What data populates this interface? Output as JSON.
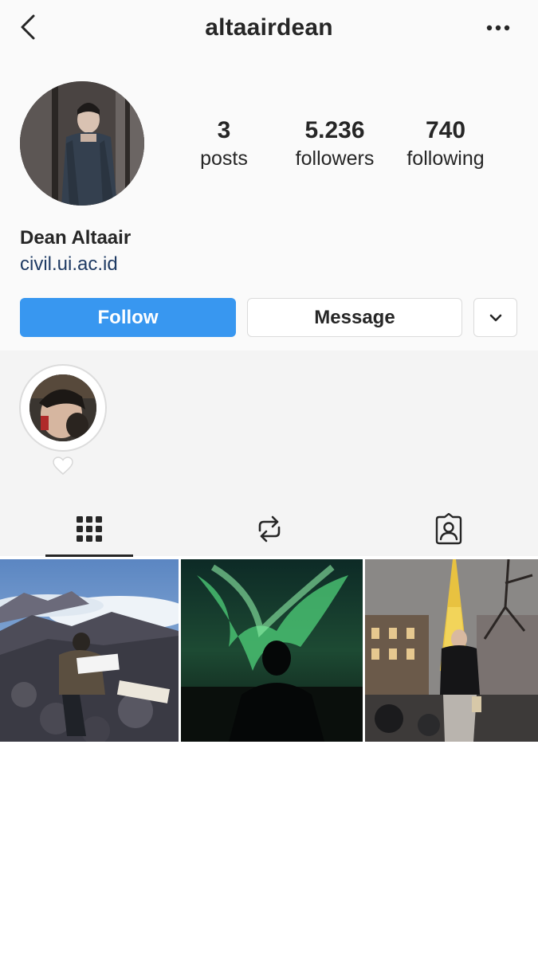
{
  "nav": {
    "title": "altaairdean",
    "back_icon": "chevron-left-icon",
    "more_icon": "more-horizontal-icon"
  },
  "profile": {
    "stats": [
      {
        "value": "3",
        "label": "posts"
      },
      {
        "value": "5.236",
        "label": "followers"
      },
      {
        "value": "740",
        "label": "following"
      }
    ],
    "name": "Dean Altaair",
    "website": "civil.ui.ac.id"
  },
  "actions": {
    "follow_label": "Follow",
    "message_label": "Message",
    "dropdown_icon": "chevron-down-icon"
  },
  "highlights": [
    {
      "icon": "heart-icon"
    }
  ],
  "tabs": [
    {
      "name": "grid",
      "icon": "grid-icon",
      "active": true
    },
    {
      "name": "reposts",
      "icon": "repost-icon",
      "active": false
    },
    {
      "name": "tagged",
      "icon": "tagged-icon",
      "active": false
    }
  ],
  "posts": [
    {
      "description": "mountain summit with sign"
    },
    {
      "description": "aurora silhouette"
    },
    {
      "description": "eiffel tower at night"
    }
  ],
  "colors": {
    "accent": "#3897f0",
    "link": "#1e3a63",
    "text": "#262626",
    "border": "#dbdbdb"
  }
}
